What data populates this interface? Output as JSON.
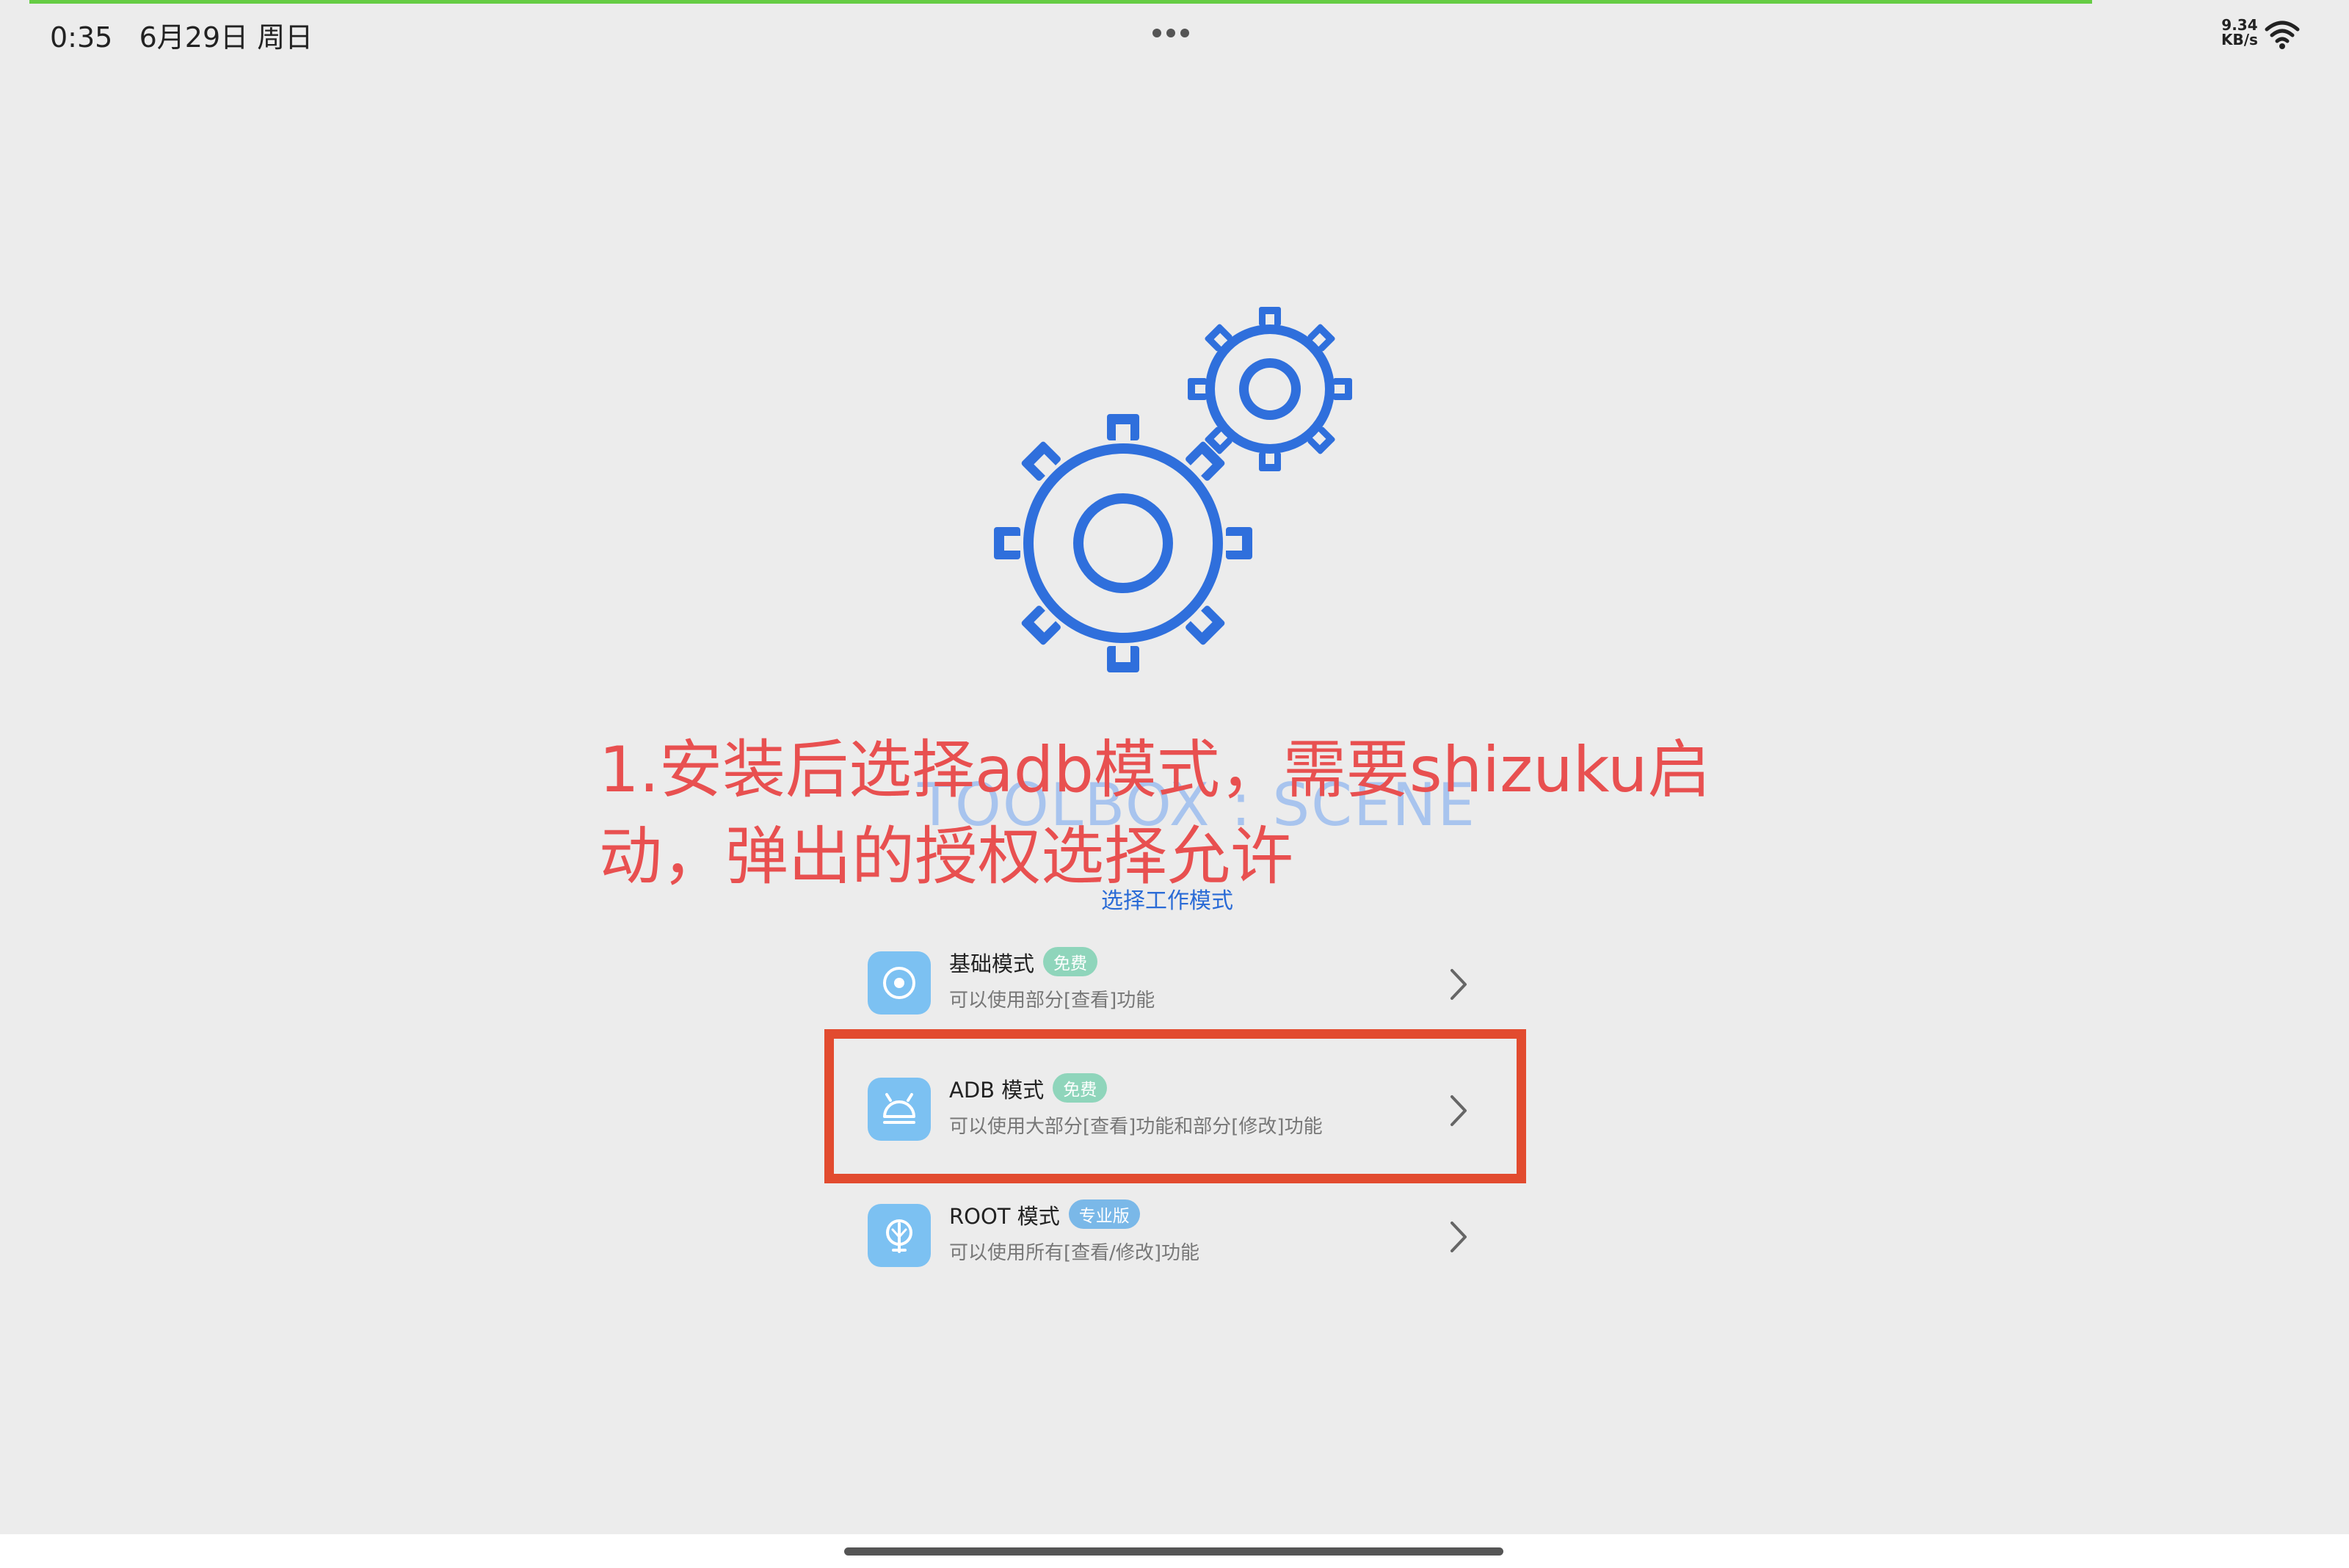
{
  "status_bar": {
    "time": "0:35",
    "date": "6月29日 周日",
    "net_speed_value": "9.34",
    "net_speed_unit": "KB/s"
  },
  "annotation": {
    "line1": "1.安装后选择adb模式，需要shizuku启",
    "line2": "动，弹出的授权选择允许"
  },
  "watermark": "TOOLBOX : SCENE",
  "section_title": "选择工作模式",
  "modes": [
    {
      "title": "基础模式",
      "badge": "免费",
      "desc": "可以使用部分[查看]功能",
      "icon": "disc-icon"
    },
    {
      "title": "ADB 模式",
      "badge": "免费",
      "desc": "可以使用大部分[查看]功能和部分[修改]功能",
      "icon": "android-icon"
    },
    {
      "title": "ROOT 模式",
      "badge": "专业版",
      "desc": "可以使用所有[查看/修改]功能",
      "icon": "root-icon"
    }
  ],
  "colors": {
    "accent_blue": "#2f6fdc",
    "annotation_red": "#e85050",
    "highlight_box": "#e24b2f",
    "badge_free": "#8fd5bb",
    "badge_pro": "#7ab8e8",
    "icon_bg": "#7cc1f2",
    "background": "#ececec"
  }
}
